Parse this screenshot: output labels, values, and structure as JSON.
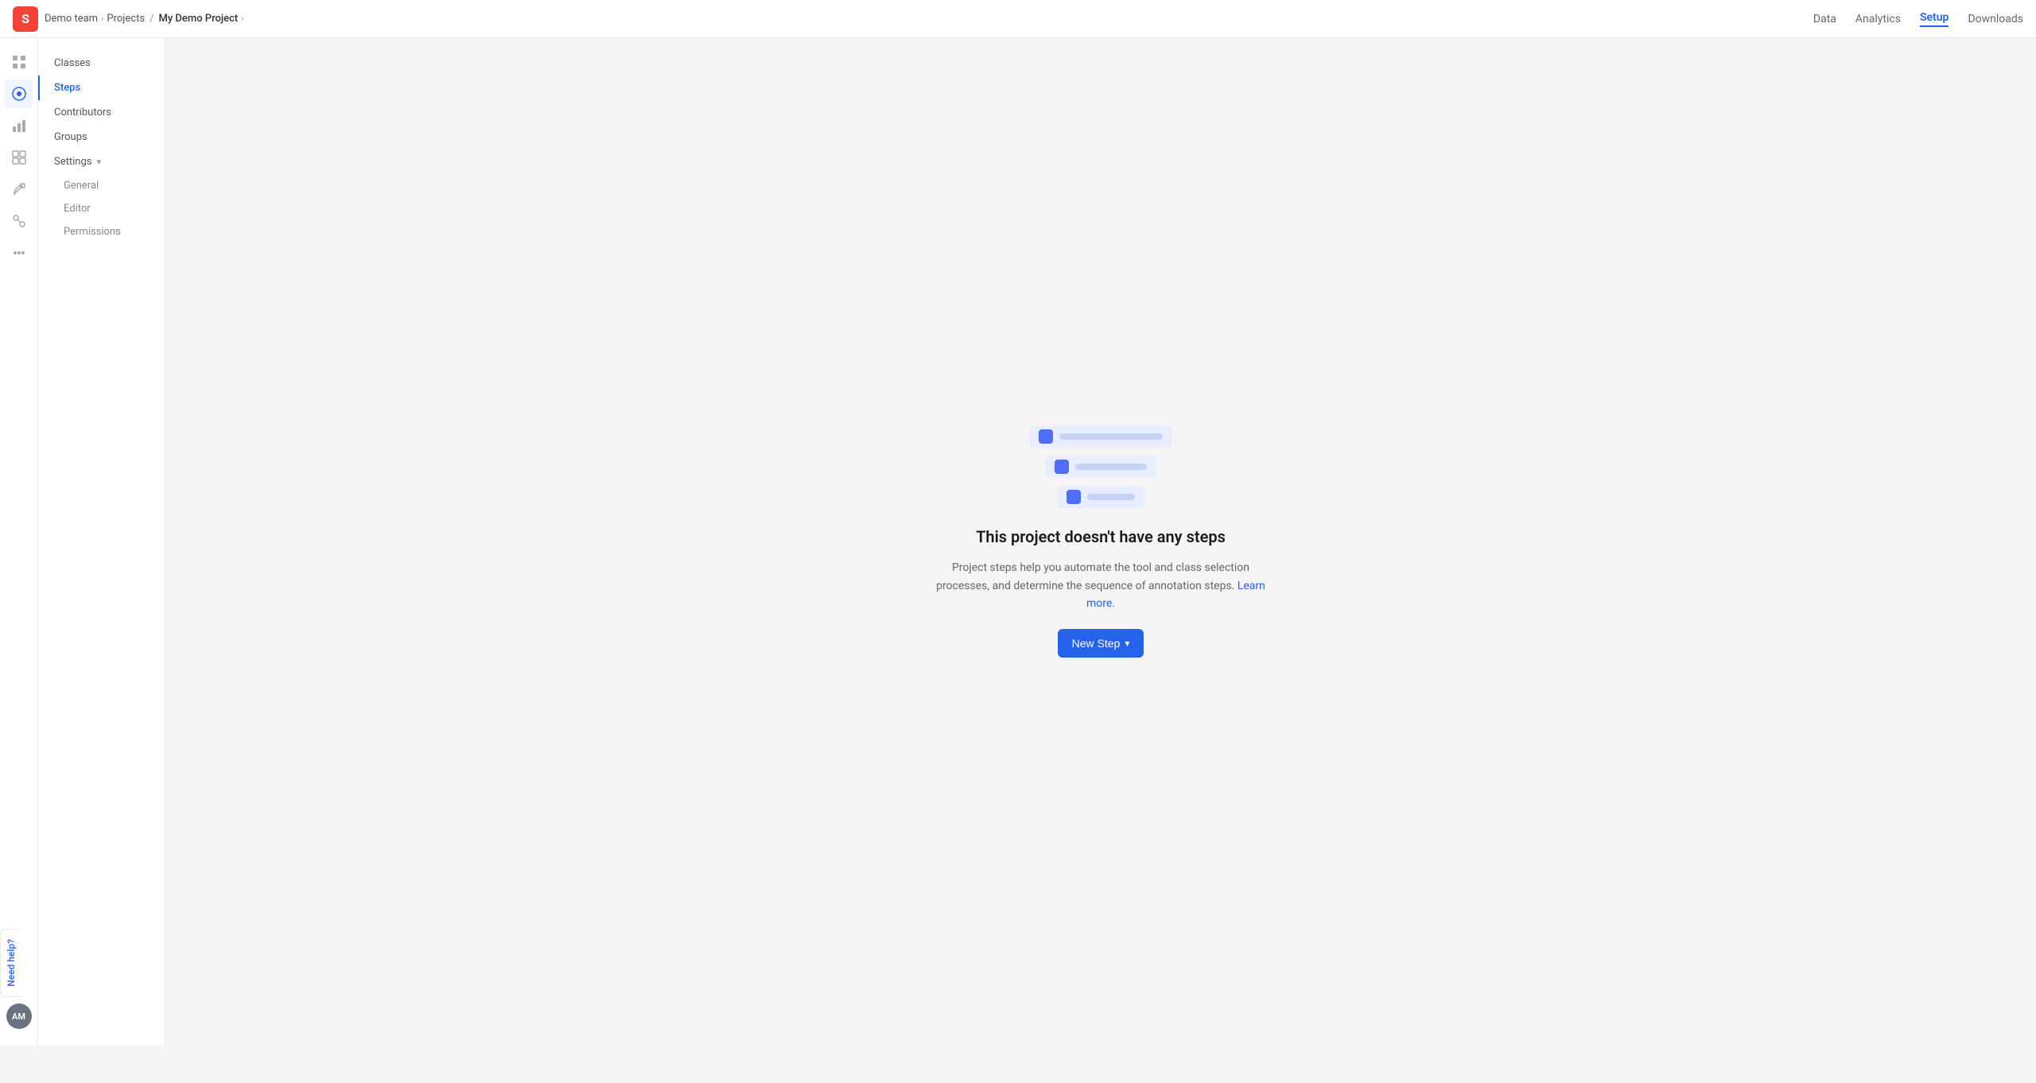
{
  "brand": {
    "logo_letter": "S",
    "logo_color": "#f44336"
  },
  "breadcrumb": {
    "team": "Demo team",
    "projects": "Projects",
    "current_project": "My Demo Project"
  },
  "top_nav": {
    "links": [
      {
        "label": "Data",
        "id": "data",
        "active": false
      },
      {
        "label": "Analytics",
        "id": "analytics",
        "active": false
      },
      {
        "label": "Setup",
        "id": "setup",
        "active": true
      },
      {
        "label": "Downloads",
        "id": "downloads",
        "active": false
      }
    ]
  },
  "icon_sidebar": {
    "items": [
      {
        "id": "dashboard",
        "icon": "⊞",
        "active": false
      },
      {
        "id": "tag",
        "icon": "◈",
        "active": true
      },
      {
        "id": "stats",
        "icon": "⋮⋮",
        "active": false
      },
      {
        "id": "grid",
        "icon": "⊞",
        "active": false
      },
      {
        "id": "tool",
        "icon": "⚒",
        "active": false
      },
      {
        "id": "integrations",
        "icon": "⊕",
        "active": false
      },
      {
        "id": "apps",
        "icon": "⊞",
        "active": false
      }
    ],
    "avatar": "AM"
  },
  "menu_sidebar": {
    "items": [
      {
        "label": "Classes",
        "id": "classes",
        "active": false
      },
      {
        "label": "Steps",
        "id": "steps",
        "active": true
      },
      {
        "label": "Contributors",
        "id": "contributors",
        "active": false
      },
      {
        "label": "Groups",
        "id": "groups",
        "active": false
      },
      {
        "label": "Settings",
        "id": "settings",
        "active": false,
        "expanded": true,
        "sub_items": [
          {
            "label": "General",
            "id": "general"
          },
          {
            "label": "Editor",
            "id": "editor"
          },
          {
            "label": "Permissions",
            "id": "permissions"
          }
        ]
      }
    ]
  },
  "empty_state": {
    "title": "This project doesn't have any steps",
    "description": "Project steps help you automate the tool and class selection processes, and determine the sequence of annotation steps.",
    "learn_more_label": "Learn more.",
    "learn_more_url": "#",
    "button_label": "New Step"
  },
  "help_widget": {
    "label": "Need help?"
  }
}
